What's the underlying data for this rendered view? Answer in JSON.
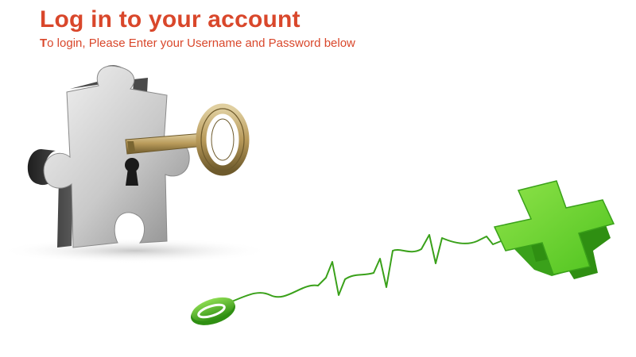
{
  "header": {
    "title": "Log in to your account",
    "subtitle_first": "T",
    "subtitle_rest": "o login, Please Enter your Username and Password below"
  },
  "illustrations": {
    "puzzle": "puzzle-piece-with-key-icon",
    "mouse": "computer-mouse-icon",
    "cross": "green-plus-cross-icon"
  },
  "colors": {
    "title": "#d9472b",
    "cross_green": "#4fc31f",
    "key_gold": "#b89a5a"
  }
}
